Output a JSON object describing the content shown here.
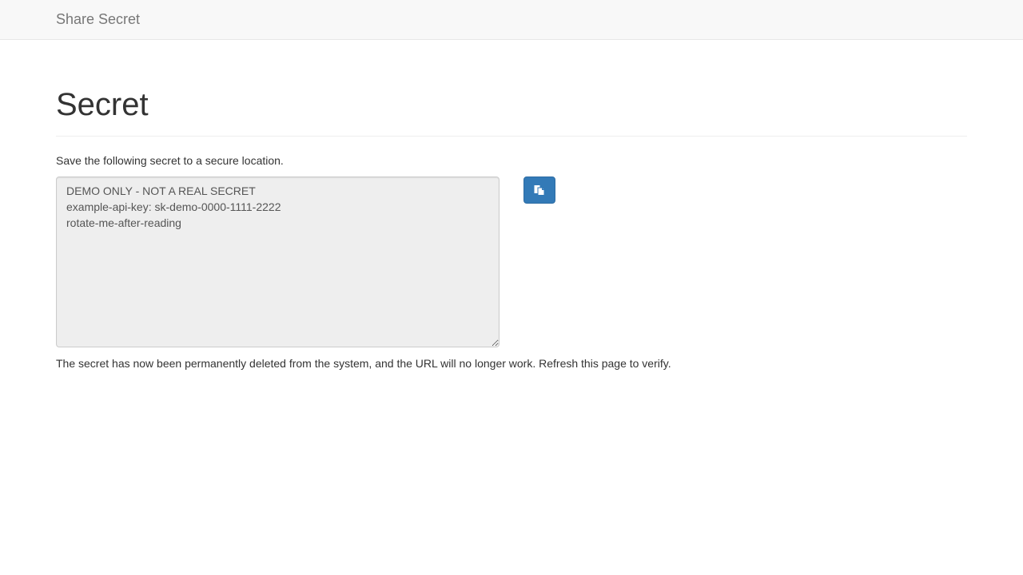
{
  "navbar": {
    "brand": "Share Secret"
  },
  "main": {
    "title": "Secret",
    "instruction": "Save the following secret to a secure location.",
    "secret_value": "DEMO ONLY - NOT A REAL SECRET\nexample-api-key: sk-demo-0000-1111-2222\nrotate-me-after-reading",
    "copy_icon": "copy-icon",
    "notice": "The secret has now been permanently deleted from the system, and the URL will no longer work. Refresh this page to verify."
  },
  "colors": {
    "navbar_bg": "#f8f8f8",
    "primary_button": "#337ab7",
    "textarea_bg": "#eeeeee"
  }
}
